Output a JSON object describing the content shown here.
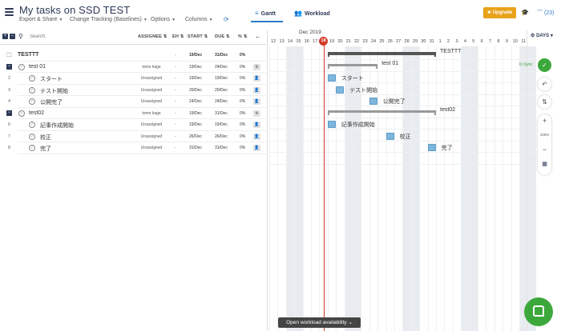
{
  "header": {
    "title": "My tasks on SSD TEST",
    "menus": [
      "Export & Share",
      "Change Tracking (Baselines)",
      "Options",
      "Columns"
    ],
    "tabs": [
      "Gantt",
      "Workload"
    ],
    "upgrade_label": "Upgrade",
    "notifications": "(23)"
  },
  "list": {
    "search_placeholder": "Search:",
    "columns": [
      "ASSIGNEE",
      "EH",
      "START",
      "DUE",
      "%"
    ],
    "rows": [
      {
        "num": "",
        "name": "TESTTT",
        "assignee": "",
        "eh": "-",
        "start": "19/Dec",
        "due": "31/Dec",
        "pct": "0%"
      },
      {
        "num": "1",
        "name": "test 01",
        "assignee": "tomo kage",
        "eh": "-",
        "start": "19/Dec",
        "due": "24/Dec",
        "pct": "0%",
        "avatar": "tk"
      },
      {
        "num": "2",
        "name": "スタート",
        "assignee": "Unassigned",
        "eh": "-",
        "start": "19/Dec",
        "due": "19/Dec",
        "pct": "0%"
      },
      {
        "num": "3",
        "name": "テスト開始",
        "assignee": "Unassigned",
        "eh": "-",
        "start": "20/Dec",
        "due": "20/Dec",
        "pct": "0%"
      },
      {
        "num": "4",
        "name": "公開完了",
        "assignee": "Unassigned",
        "eh": "-",
        "start": "24/Dec",
        "due": "24/Dec",
        "pct": "0%"
      },
      {
        "num": "5",
        "name": "test02",
        "assignee": "tomo kage",
        "eh": "-",
        "start": "19/Dec",
        "due": "31/Dec",
        "pct": "0%",
        "avatar": "tk"
      },
      {
        "num": "6",
        "name": "記事作成開始",
        "assignee": "Unassigned",
        "eh": "-",
        "start": "19/Dec",
        "due": "19/Dec",
        "pct": "0%"
      },
      {
        "num": "7",
        "name": "校正",
        "assignee": "Unassigned",
        "eh": "-",
        "start": "26/Dec",
        "due": "26/Dec",
        "pct": "0%"
      },
      {
        "num": "8",
        "name": "完了",
        "assignee": "Unassigned",
        "eh": "-",
        "start": "31/Dec",
        "due": "31/Dec",
        "pct": "0%"
      }
    ]
  },
  "gantt": {
    "month": "Dec 2019",
    "days": [
      "12",
      "13",
      "14",
      "15",
      "16",
      "17",
      "18",
      "19",
      "20",
      "21",
      "22",
      "23",
      "24",
      "25",
      "26",
      "27",
      "28",
      "29",
      "30",
      "31",
      "1",
      "2",
      "3",
      "4",
      "5",
      "6",
      "7",
      "8",
      "9",
      "10",
      "11"
    ],
    "today": "18",
    "days_label": "DAYS",
    "bars": [
      {
        "label": "TESTTT",
        "start_day": "19",
        "end_day": "31"
      },
      {
        "label": "test 01",
        "start_day": "19",
        "end_day": "24"
      },
      {
        "label": "スタート",
        "day": "19"
      },
      {
        "label": "テスト開始",
        "day": "20"
      },
      {
        "label": "公開完了",
        "day": "24"
      },
      {
        "label": "test02",
        "start_day": "19",
        "end_day": "31"
      },
      {
        "label": "記事作成開始",
        "day": "19"
      },
      {
        "label": "校正",
        "day": "26"
      },
      {
        "label": "完了",
        "day": "31"
      }
    ]
  },
  "side": {
    "sync_label": "In Sync",
    "zoom": "100%"
  },
  "footer": {
    "workload_label": "Open workload availability"
  },
  "colors": {
    "accent": "#2d7cc4",
    "today": "#d23a2a",
    "task": "#7fb6dd",
    "green": "#3ca83c",
    "upgrade": "#e8a21a"
  }
}
